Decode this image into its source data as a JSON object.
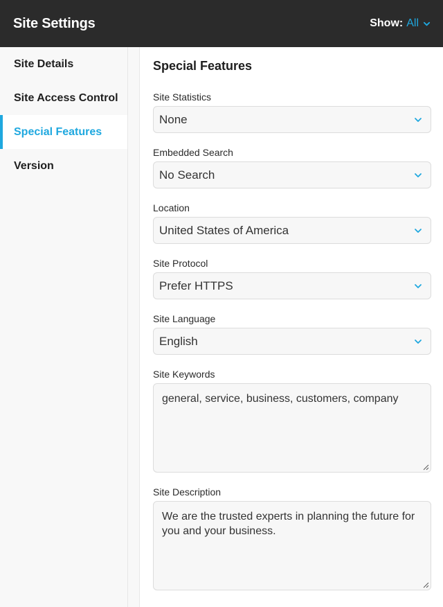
{
  "header": {
    "title": "Site Settings",
    "show_label": "Show:",
    "show_value": "All"
  },
  "colors": {
    "accent": "#1fa8df",
    "header_bg": "#2b2b2b"
  },
  "sidebar": {
    "items": [
      {
        "label": "Site Details",
        "active": false
      },
      {
        "label": "Site Access Control",
        "active": false
      },
      {
        "label": "Special Features",
        "active": true
      },
      {
        "label": "Version",
        "active": false
      }
    ]
  },
  "main": {
    "title": "Special Features",
    "fields": {
      "site_statistics": {
        "label": "Site Statistics",
        "value": "None"
      },
      "embedded_search": {
        "label": "Embedded Search",
        "value": "No Search"
      },
      "location": {
        "label": "Location",
        "value": "United States of America"
      },
      "site_protocol": {
        "label": "Site Protocol",
        "value": "Prefer HTTPS"
      },
      "site_language": {
        "label": "Site Language",
        "value": "English"
      },
      "site_keywords": {
        "label": "Site Keywords",
        "value": "general, service, business, customers, company"
      },
      "site_description": {
        "label": "Site Description",
        "value": "We are the trusted experts in planning the future for you and your business."
      }
    }
  },
  "icons": {
    "dropdown": "chevron-down-icon",
    "resize": "resize-handle-icon"
  }
}
